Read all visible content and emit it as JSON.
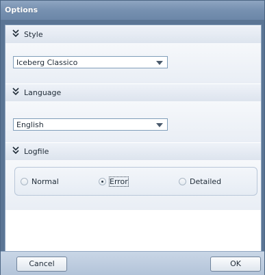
{
  "window": {
    "title": "Options"
  },
  "sections": {
    "style": {
      "label": "Style",
      "selected": "Iceberg Classico"
    },
    "language": {
      "label": "Language",
      "selected": "English"
    },
    "logfile": {
      "label": "Logfile",
      "options": [
        "Normal",
        "Error",
        "Detailed"
      ],
      "selected": "Error"
    }
  },
  "buttons": {
    "cancel": "Cancel",
    "ok": "OK"
  },
  "icons": {
    "section_toggle": "double-chevron-down-icon",
    "dropdown": "triangle-down-icon"
  },
  "colors": {
    "title_bar": "#7690b0",
    "section_header": "#dde4ee",
    "footer": "#b3c4d9"
  }
}
